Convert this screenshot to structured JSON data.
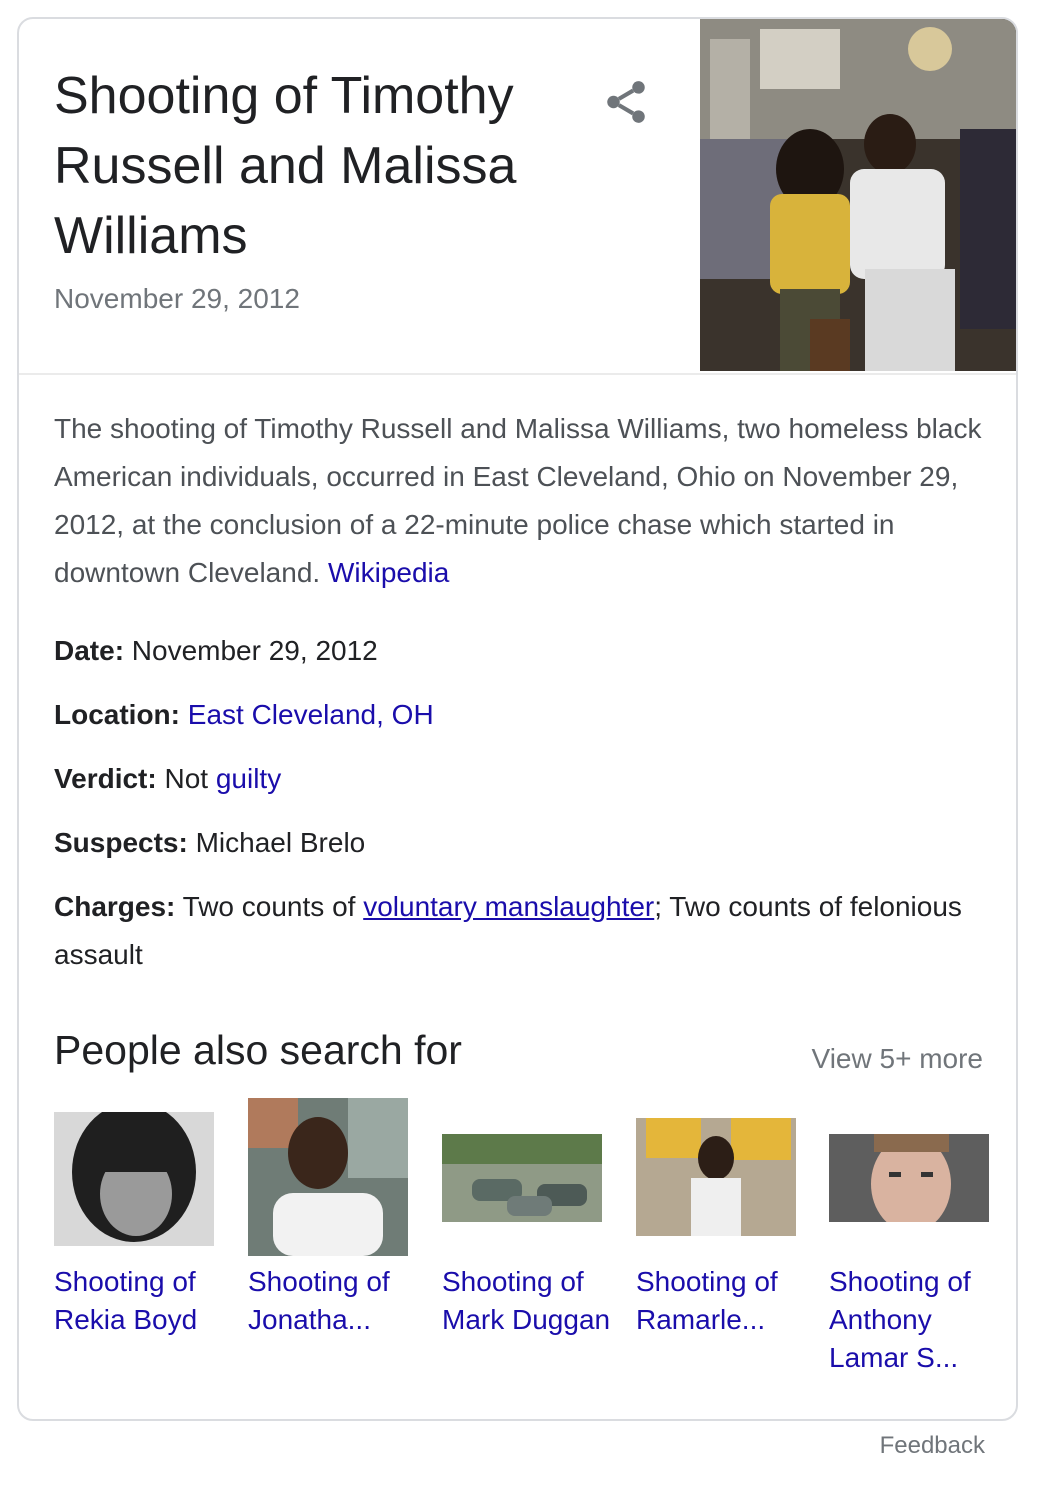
{
  "header": {
    "title": "Shooting of Timothy Russell and Malissa Williams",
    "subtitle": "November 29, 2012",
    "share_icon": "share-icon",
    "photo_alt": "photo-two-people"
  },
  "description": {
    "text": "The shooting of Timothy Russell and Malissa Williams, two homeless black American individuals, occurred in East Cleveland, Ohio on November 29, 2012, at the conclusion of a 22-minute police chase which started in downtown Cleveland.",
    "source_link": "Wikipedia"
  },
  "facts": {
    "date_label": "Date:",
    "date_value": "November 29, 2012",
    "location_label": "Location:",
    "location_value": "East Cleveland, OH",
    "verdict_label": "Verdict:",
    "verdict_pre": "Not",
    "verdict_link": "guilty",
    "suspects_label": "Suspects:",
    "suspects_value": "Michael Brelo",
    "charges_label": "Charges:",
    "charges_pre": "Two counts of",
    "charges_link": "voluntary manslaughter",
    "charges_post": "; Two counts of felonious assault"
  },
  "pasf": {
    "title": "People also search for",
    "view_more": "View 5+ more",
    "items": [
      {
        "label": "Shooting of Rekia Boyd"
      },
      {
        "label": "Shooting of Jonatha..."
      },
      {
        "label": "Shooting of Mark Duggan"
      },
      {
        "label": "Shooting of Ramarle..."
      },
      {
        "label": "Shooting of Anthony Lamar S..."
      }
    ]
  },
  "footer": {
    "feedback": "Feedback"
  },
  "colors": {
    "link": "#1a0dab",
    "muted": "#70757a",
    "border": "#dadce0"
  }
}
